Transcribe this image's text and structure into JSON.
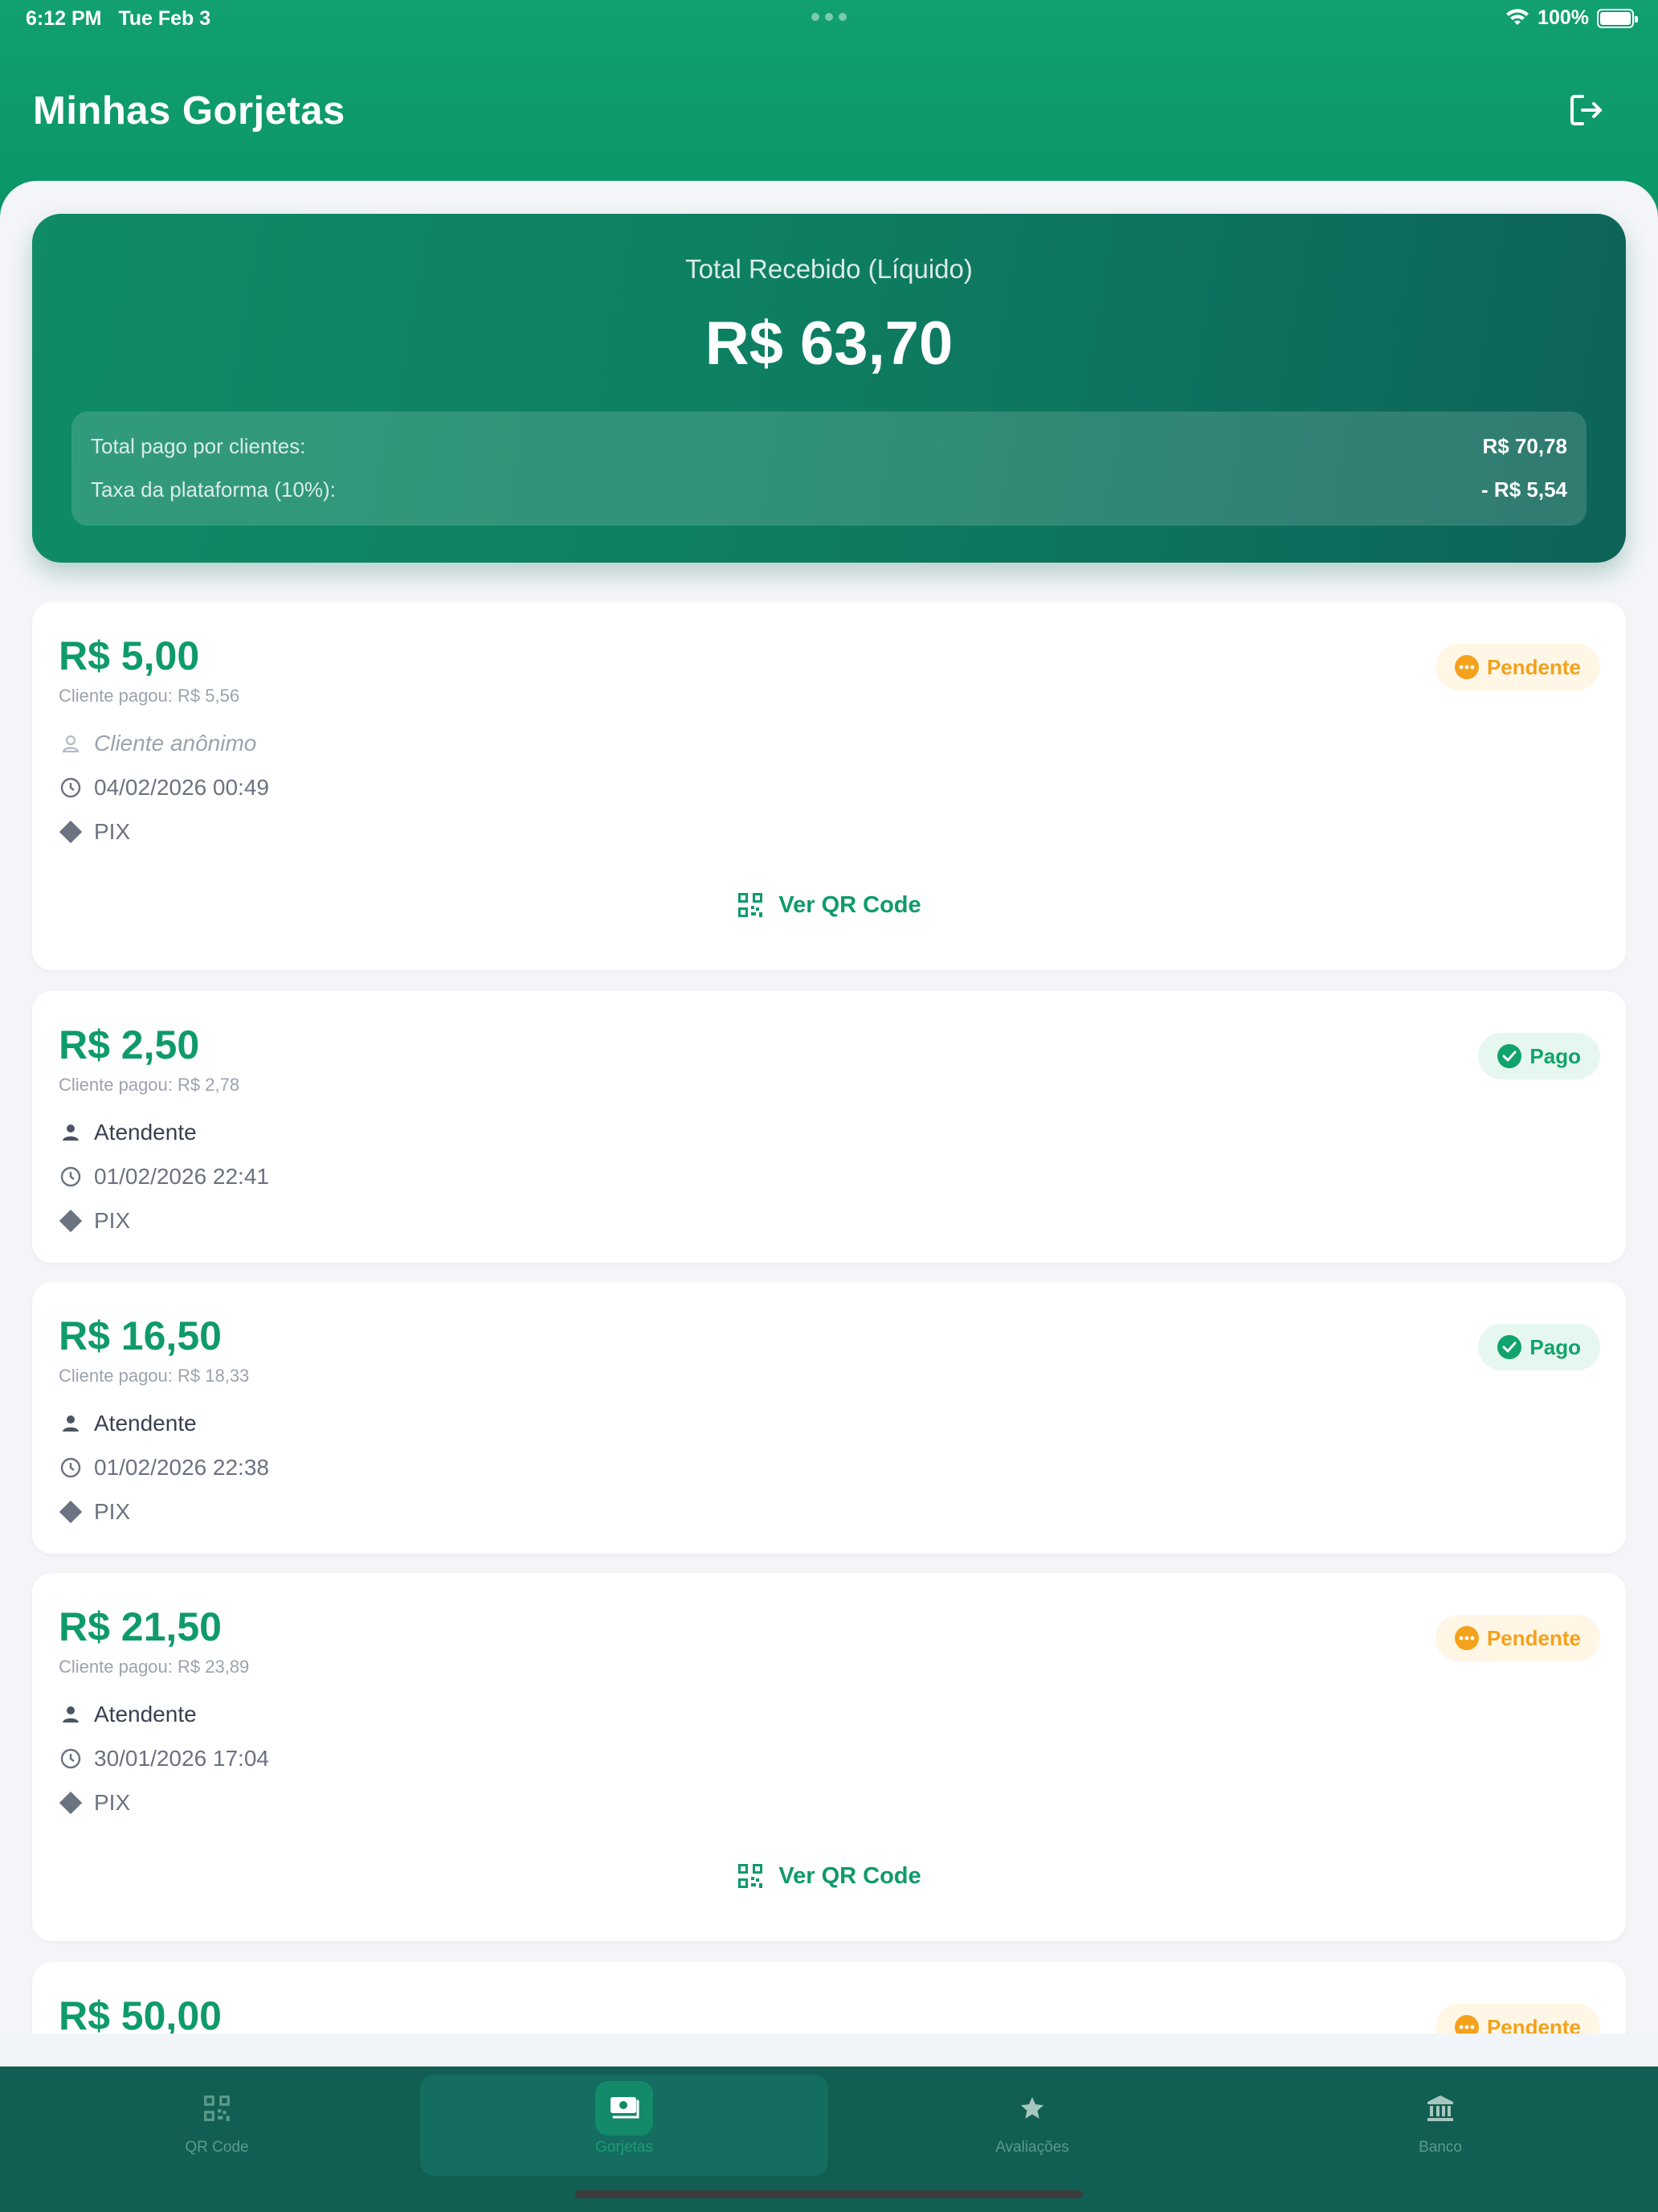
{
  "status_bar": {
    "time": "6:12 PM",
    "date": "Tue Feb 3",
    "battery": "100%"
  },
  "header": {
    "title": "Minhas Gorjetas",
    "logout_icon": "logout-icon"
  },
  "summary": {
    "label": "Total Recebido (Líquido)",
    "amount": "R$ 63,70",
    "paid_by_clients_label": "Total pago por clientes:",
    "paid_by_clients_value": "R$ 70,78",
    "fee_label": "Taxa da plataforma (10%):",
    "fee_value": "- R$ 5,54"
  },
  "tips": [
    {
      "amount": "R$ 5,00",
      "client_paid": "Cliente pagou: R$ 5,56",
      "client": "Cliente anônimo",
      "datetime": "04/02/2026 00:49",
      "method": "PIX",
      "status": "Pendente",
      "qr_label": "Ver QR Code"
    },
    {
      "amount": "R$ 2,50",
      "client_paid": "Cliente pagou: R$ 2,78",
      "client": "Atendente",
      "datetime": "01/02/2026 22:41",
      "method": "PIX",
      "status": "Pago"
    },
    {
      "amount": "R$ 16,50",
      "client_paid": "Cliente pagou: R$ 18,33",
      "client": "Atendente",
      "datetime": "01/02/2026 22:38",
      "method": "PIX",
      "status": "Pago"
    },
    {
      "amount": "R$ 21,50",
      "client_paid": "Cliente pagou: R$ 23,89",
      "client": "Atendente",
      "datetime": "30/01/2026 17:04",
      "method": "PIX",
      "status": "Pendente",
      "qr_label": "Ver QR Code"
    },
    {
      "amount": "R$ 50,00",
      "status": "Pendente"
    }
  ],
  "tabbar": [
    {
      "label": "QR Code",
      "icon": "qr-code-icon"
    },
    {
      "label": "Gorjetas",
      "icon": "money-icon",
      "active": true
    },
    {
      "label": "Avaliações",
      "icon": "star-icon"
    },
    {
      "label": "Banco",
      "icon": "bank-icon"
    }
  ],
  "colors": {
    "brand": "#0f9a6c",
    "pending": "#f4a11b",
    "paid": "#11a36c",
    "tabbar": "#115e52"
  }
}
